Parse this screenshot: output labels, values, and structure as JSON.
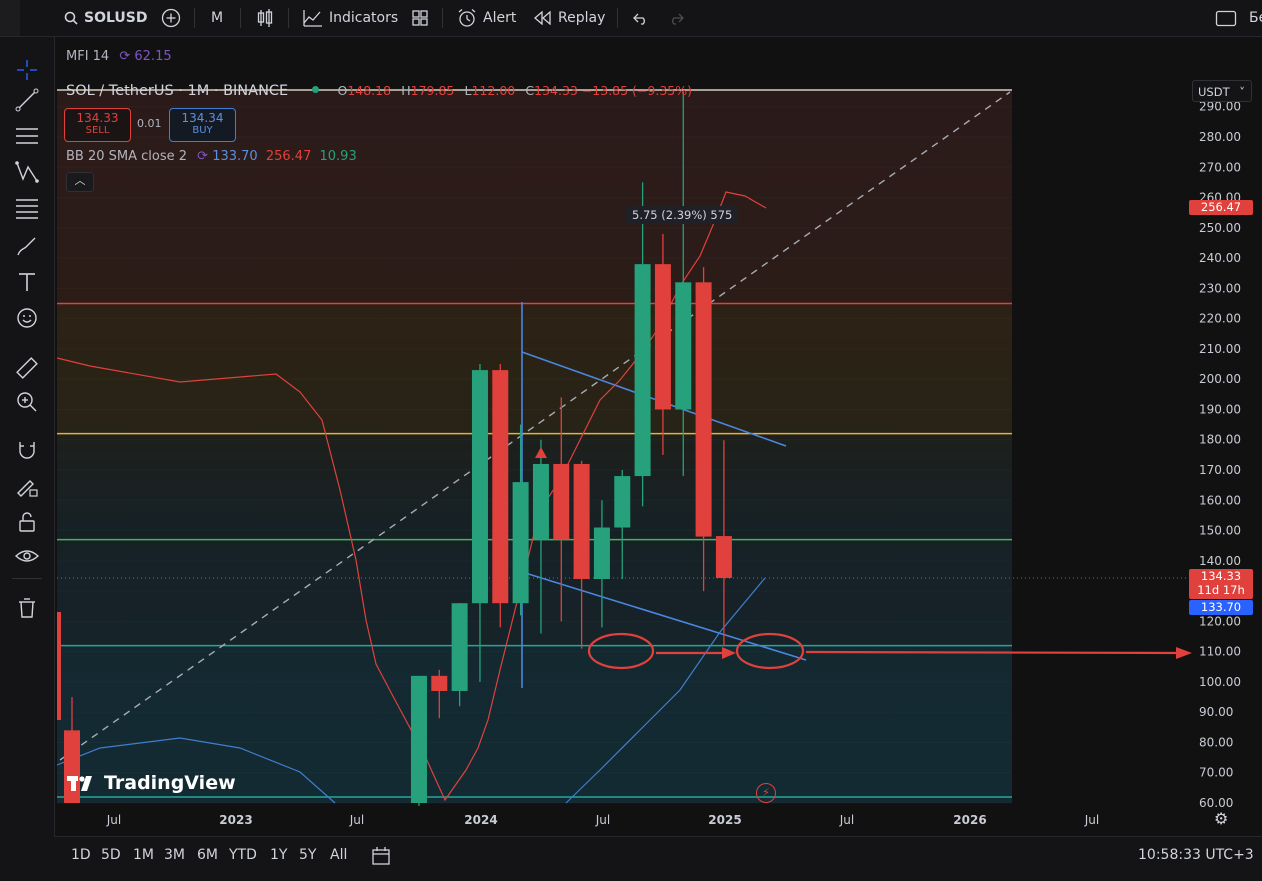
{
  "toolbar": {
    "symbol": "SOLUSD",
    "interval": "M",
    "indicators_label": "Indicators",
    "alert_label": "Alert",
    "replay_label": "Replay",
    "right_text": "Бе"
  },
  "legend": {
    "mfi_name": "MFI 14",
    "mfi_value": "62.15",
    "title": "SOL / TetherUS · 1M · BINANCE",
    "o_label": "O",
    "o_value": "148.18",
    "h_label": "H",
    "h_value": "179.85",
    "l_label": "L",
    "l_value": "112.00",
    "c_label": "C",
    "c_value": "134.33 −13.85 (−9.35%)",
    "sell_price": "134.33",
    "sell_label": "SELL",
    "spread": "0.01",
    "buy_price": "134.34",
    "buy_label": "BUY",
    "bb_name": "BB 20 SMA close 2",
    "bb_basis": "133.70",
    "bb_upper": "256.47",
    "bb_lower": "10.93"
  },
  "chart_tooltip": "5.75 (2.39%) 575",
  "watermark": "TradingView",
  "currency": "USDT",
  "price_labels": {
    "upper_band": "256.47",
    "last_price": "134.33",
    "countdown": "11d 17h",
    "basis": "133.70"
  },
  "time_axis": [
    "Jul",
    "2023",
    "Jul",
    "2024",
    "Jul",
    "2025",
    "Jul",
    "2026",
    "Jul"
  ],
  "bottom": {
    "ranges": [
      "1D",
      "5D",
      "1M",
      "3M",
      "6M",
      "YTD",
      "1Y",
      "5Y",
      "All"
    ],
    "clock": "10:58:33 UTC+3"
  },
  "colors": {
    "up": "#26a17b",
    "down": "#e0413c",
    "bb_upper": "#e0413c",
    "bb_lower": "#3f7fd0",
    "accent_blue": "#2962ff"
  },
  "chart_data": {
    "type": "candlestick",
    "title": "SOL / TetherUS · 1M · BINANCE",
    "ylim": [
      60,
      300
    ],
    "y_ticks": [
      60,
      70,
      80,
      90,
      100,
      110,
      120,
      130,
      140,
      150,
      160,
      170,
      180,
      190,
      200,
      210,
      220,
      230,
      240,
      250,
      260,
      270,
      280,
      290
    ],
    "candles": [
      {
        "x": "2022-04",
        "o": 84,
        "h": 95,
        "l": 60,
        "c": 60
      },
      {
        "x": "2023-10",
        "o": 60,
        "h": 102,
        "l": 59,
        "c": 102
      },
      {
        "x": "2023-11",
        "o": 102,
        "h": 104,
        "l": 88,
        "c": 97
      },
      {
        "x": "2023-12",
        "o": 97,
        "h": 126,
        "l": 92,
        "c": 126
      },
      {
        "x": "2024-01",
        "o": 126,
        "h": 205,
        "l": 100,
        "c": 203
      },
      {
        "x": "2024-02",
        "o": 203,
        "h": 205,
        "l": 118,
        "c": 126
      },
      {
        "x": "2024-03",
        "o": 126,
        "h": 185,
        "l": 122,
        "c": 166
      },
      {
        "x": "2024-04",
        "o": 147,
        "h": 180,
        "l": 116,
        "c": 172
      },
      {
        "x": "2024-05",
        "o": 172,
        "h": 194,
        "l": 120,
        "c": 147
      },
      {
        "x": "2024-06",
        "o": 172,
        "h": 173,
        "l": 111,
        "c": 134
      },
      {
        "x": "2024-07",
        "o": 134,
        "h": 160,
        "l": 118,
        "c": 151
      },
      {
        "x": "2024-08",
        "o": 151,
        "h": 170,
        "l": 134,
        "c": 168
      },
      {
        "x": "2024-09",
        "o": 168,
        "h": 265,
        "l": 158,
        "c": 238
      },
      {
        "x": "2024-10",
        "o": 238,
        "h": 248,
        "l": 175,
        "c": 190
      },
      {
        "x": "2024-11",
        "o": 190,
        "h": 295,
        "l": 168,
        "c": 232
      },
      {
        "x": "2024-12",
        "o": 232,
        "h": 237,
        "l": 130,
        "c": 148
      },
      {
        "x": "2025-01",
        "o": 148.18,
        "h": 179.85,
        "l": 112.0,
        "c": 134.33
      }
    ],
    "horizontal_levels": [
      {
        "value": 225,
        "color": "#e0413c"
      },
      {
        "value": 182,
        "color": "#e8b130"
      },
      {
        "value": 147,
        "color": "#47b35a"
      },
      {
        "value": 112,
        "color": "#26a69a"
      },
      {
        "value": 62,
        "color": "#26a69a"
      }
    ],
    "bollinger": {
      "basis": 133.7,
      "upper": 256.47,
      "lower": 10.93
    }
  }
}
